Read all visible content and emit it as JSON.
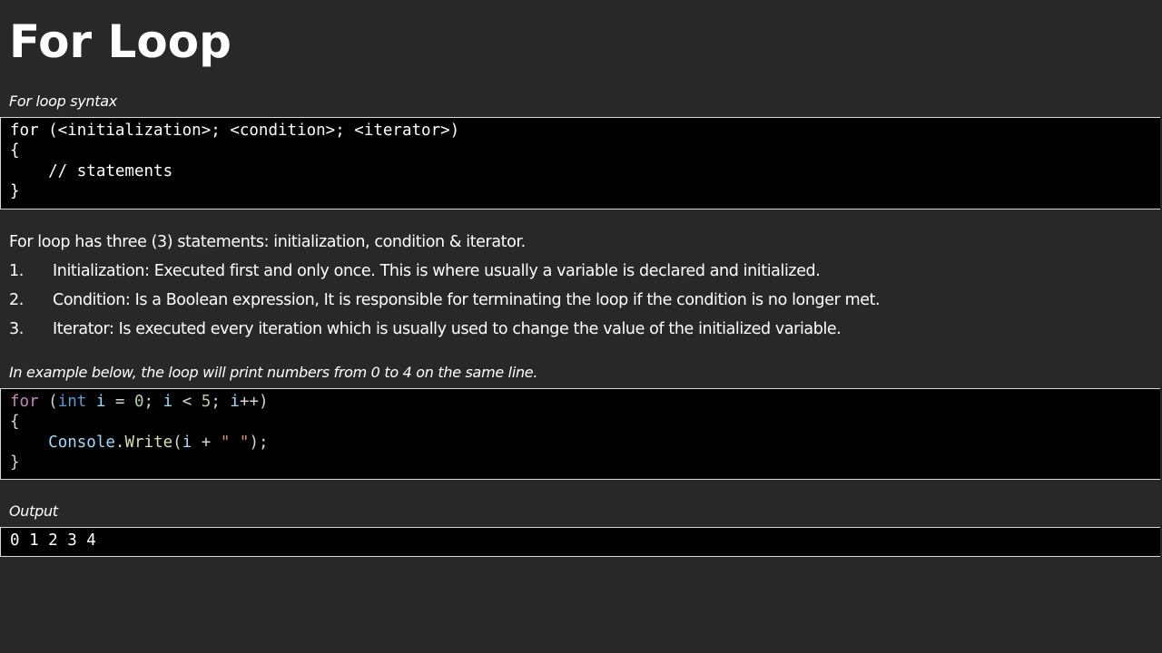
{
  "title": "For Loop",
  "syntax_section": {
    "caption": "For loop syntax",
    "code_lines": [
      "for (<initialization>; <condition>; <iterator>)",
      "{",
      "    // statements",
      "}"
    ]
  },
  "description": {
    "intro": "For loop has three (3) statements: initialization, condition & iterator.",
    "items": [
      {
        "number": "1.",
        "text": "Initialization: Executed first and only once. This is where usually a variable is declared and initialized."
      },
      {
        "number": "2.",
        "text": "Condition: Is a Boolean expression, It is responsible for terminating the loop if the condition is no longer met."
      },
      {
        "number": "3.",
        "text": "Iterator: Is executed every iteration which is usually used to change the value of the initialized variable."
      }
    ]
  },
  "example_section": {
    "caption": "In example below, the loop will print numbers from 0 to 4 on the same line.",
    "code": {
      "kw_for": "for",
      "paren_open": " (",
      "type_int": "int",
      "var_i1": " i",
      "op_assign": " = ",
      "lit_0": "0",
      "semi1": "; ",
      "var_i2": "i",
      "op_lt": " < ",
      "lit_5": "5",
      "semi2": "; ",
      "var_i3": "i",
      "op_inc": "++)",
      "brace_open": "{",
      "indent": "    ",
      "cls_console": "Console",
      "dot": ".",
      "fn_write": "Write",
      "paren2": "(",
      "var_i4": "i",
      "op_plus": " + ",
      "str_space": "\" \"",
      "close_call": ");",
      "brace_close": "}"
    }
  },
  "output_section": {
    "caption": "Output",
    "value": "0 1 2 3 4"
  }
}
